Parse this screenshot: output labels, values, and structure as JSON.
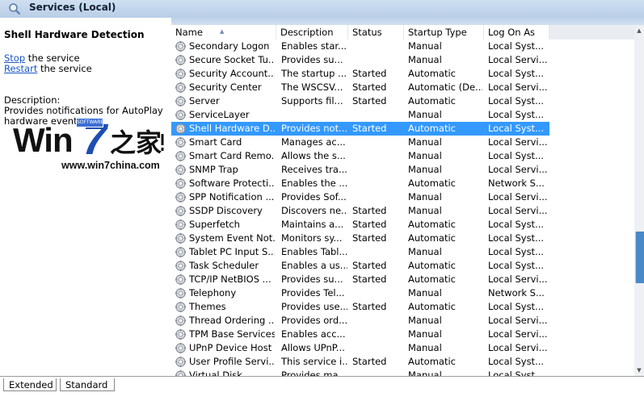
{
  "header": {
    "title": "Services (Local)",
    "icon": "services-magnifier-icon"
  },
  "description_pane": {
    "service_title": "Shell Hardware Detection",
    "stop_link": "Stop",
    "stop_suffix": " the service",
    "restart_link": "Restart",
    "restart_suffix": " the service",
    "description_label": "Description:",
    "description_line1": "Provides notifications for AutoPlay",
    "description_line2": "hardware events."
  },
  "watermark": {
    "win": "Win",
    "seven": "7",
    "cn": "之家",
    "url": "www.win7china.com",
    "badge": "SOFTWARE"
  },
  "columns": [
    "Name",
    "Description",
    "Status",
    "Startup Type",
    "Log On As"
  ],
  "selected_index": 6,
  "rows": [
    {
      "name": "Secondary Logon",
      "desc": "Enables star...",
      "status": "",
      "startup": "Manual",
      "logon": "Local Syst..."
    },
    {
      "name": "Secure Socket Tu...",
      "desc": "Provides su...",
      "status": "",
      "startup": "Manual",
      "logon": "Local Servi..."
    },
    {
      "name": "Security Account...",
      "desc": "The startup ...",
      "status": "Started",
      "startup": "Automatic",
      "logon": "Local Syst..."
    },
    {
      "name": "Security Center",
      "desc": "The WSCSV...",
      "status": "Started",
      "startup": "Automatic (De...",
      "logon": "Local Servi..."
    },
    {
      "name": "Server",
      "desc": "Supports fil...",
      "status": "Started",
      "startup": "Automatic",
      "logon": "Local Syst..."
    },
    {
      "name": "ServiceLayer",
      "desc": "",
      "status": "",
      "startup": "Manual",
      "logon": "Local Syst..."
    },
    {
      "name": "Shell Hardware D...",
      "desc": "Provides not...",
      "status": "Started",
      "startup": "Automatic",
      "logon": "Local Syst..."
    },
    {
      "name": "Smart Card",
      "desc": "Manages ac...",
      "status": "",
      "startup": "Manual",
      "logon": "Local Servi..."
    },
    {
      "name": "Smart Card Remo...",
      "desc": "Allows the s...",
      "status": "",
      "startup": "Manual",
      "logon": "Local Syst..."
    },
    {
      "name": "SNMP Trap",
      "desc": "Receives tra...",
      "status": "",
      "startup": "Manual",
      "logon": "Local Servi..."
    },
    {
      "name": "Software Protecti...",
      "desc": "Enables the ...",
      "status": "",
      "startup": "Automatic",
      "logon": "Network S..."
    },
    {
      "name": "SPP Notification ...",
      "desc": "Provides Sof...",
      "status": "",
      "startup": "Manual",
      "logon": "Local Servi..."
    },
    {
      "name": "SSDP Discovery",
      "desc": "Discovers ne...",
      "status": "Started",
      "startup": "Manual",
      "logon": "Local Servi..."
    },
    {
      "name": "Superfetch",
      "desc": "Maintains a...",
      "status": "Started",
      "startup": "Automatic",
      "logon": "Local Syst..."
    },
    {
      "name": "System Event Not...",
      "desc": "Monitors sy...",
      "status": "Started",
      "startup": "Automatic",
      "logon": "Local Syst..."
    },
    {
      "name": "Tablet PC Input S...",
      "desc": "Enables Tabl...",
      "status": "",
      "startup": "Manual",
      "logon": "Local Syst..."
    },
    {
      "name": "Task Scheduler",
      "desc": "Enables a us...",
      "status": "Started",
      "startup": "Automatic",
      "logon": "Local Syst..."
    },
    {
      "name": "TCP/IP NetBIOS ...",
      "desc": "Provides su...",
      "status": "Started",
      "startup": "Automatic",
      "logon": "Local Servi..."
    },
    {
      "name": "Telephony",
      "desc": "Provides Tel...",
      "status": "",
      "startup": "Manual",
      "logon": "Network S..."
    },
    {
      "name": "Themes",
      "desc": "Provides use...",
      "status": "Started",
      "startup": "Automatic",
      "logon": "Local Syst..."
    },
    {
      "name": "Thread Ordering ...",
      "desc": "Provides ord...",
      "status": "",
      "startup": "Manual",
      "logon": "Local Servi..."
    },
    {
      "name": "TPM Base Services",
      "desc": "Enables acc...",
      "status": "",
      "startup": "Manual",
      "logon": "Local Servi..."
    },
    {
      "name": "UPnP Device Host",
      "desc": "Allows UPnP...",
      "status": "",
      "startup": "Manual",
      "logon": "Local Servi..."
    },
    {
      "name": "User Profile Servi...",
      "desc": "This service i...",
      "status": "Started",
      "startup": "Automatic",
      "logon": "Local Syst..."
    },
    {
      "name": "Virtual Disk",
      "desc": "Provides ma...",
      "status": "",
      "startup": "Manual",
      "logon": "Local Syst..."
    }
  ],
  "tabs": [
    "Extended",
    "Standard"
  ],
  "colors": {
    "selection": "#3399ff",
    "link": "#1a56c4",
    "header": "#c3d5ea"
  }
}
